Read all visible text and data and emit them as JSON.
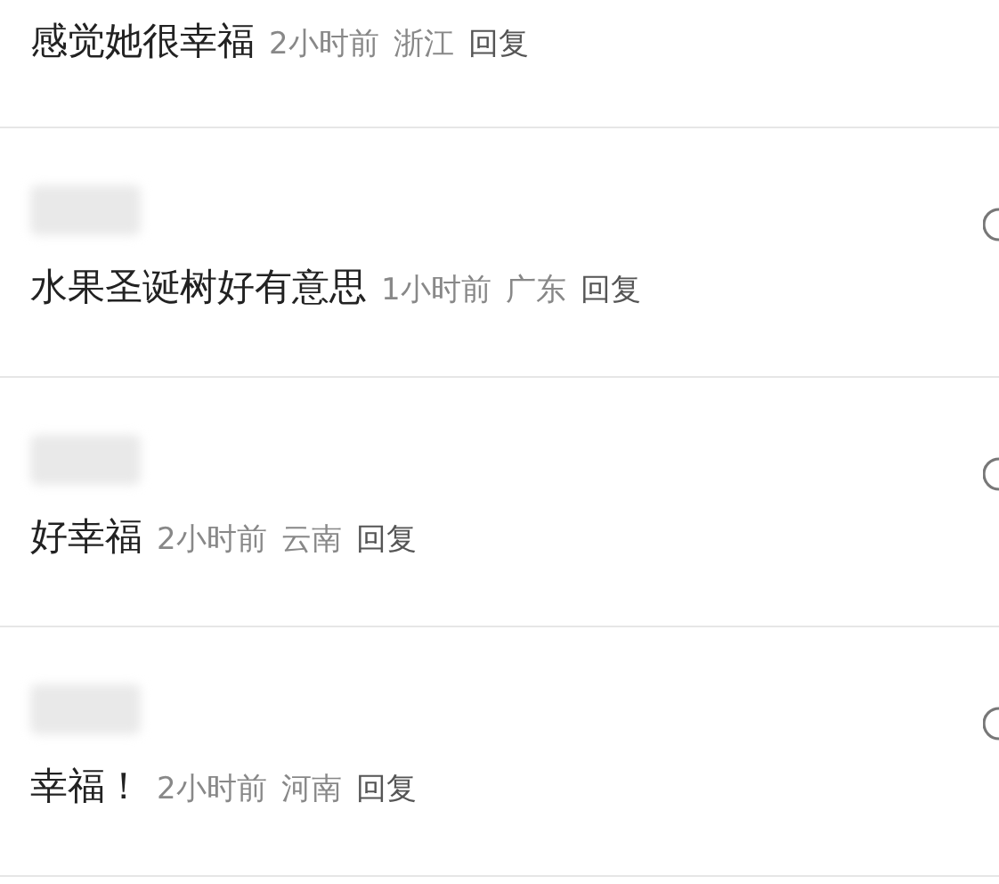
{
  "comments": [
    {
      "name_hidden": false,
      "text": "感觉她很幸福",
      "time": "2小时前",
      "location": "浙江",
      "reply": "回复"
    },
    {
      "name_hidden": true,
      "text": "水果圣诞树好有意思",
      "time": "1小时前",
      "location": "广东",
      "reply": "回复"
    },
    {
      "name_hidden": true,
      "text": "好幸福",
      "time": "2小时前",
      "location": "云南",
      "reply": "回复"
    },
    {
      "name_hidden": true,
      "text": "幸福！",
      "time": "2小时前",
      "location": "河南",
      "reply": "回复"
    }
  ]
}
